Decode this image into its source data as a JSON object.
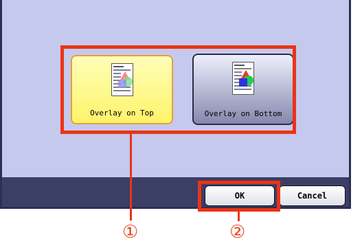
{
  "options": {
    "overlay_top_label": "Overlay on Top",
    "overlay_bottom_label": "Overlay on Bottom"
  },
  "footer": {
    "ok_label": "OK",
    "cancel_label": "Cancel"
  },
  "callouts": {
    "one": "①",
    "two": "②"
  },
  "colors": {
    "panel_bg": "#c6c9ee",
    "bar_bg": "#3b3f66",
    "highlight": "#ea3415"
  }
}
